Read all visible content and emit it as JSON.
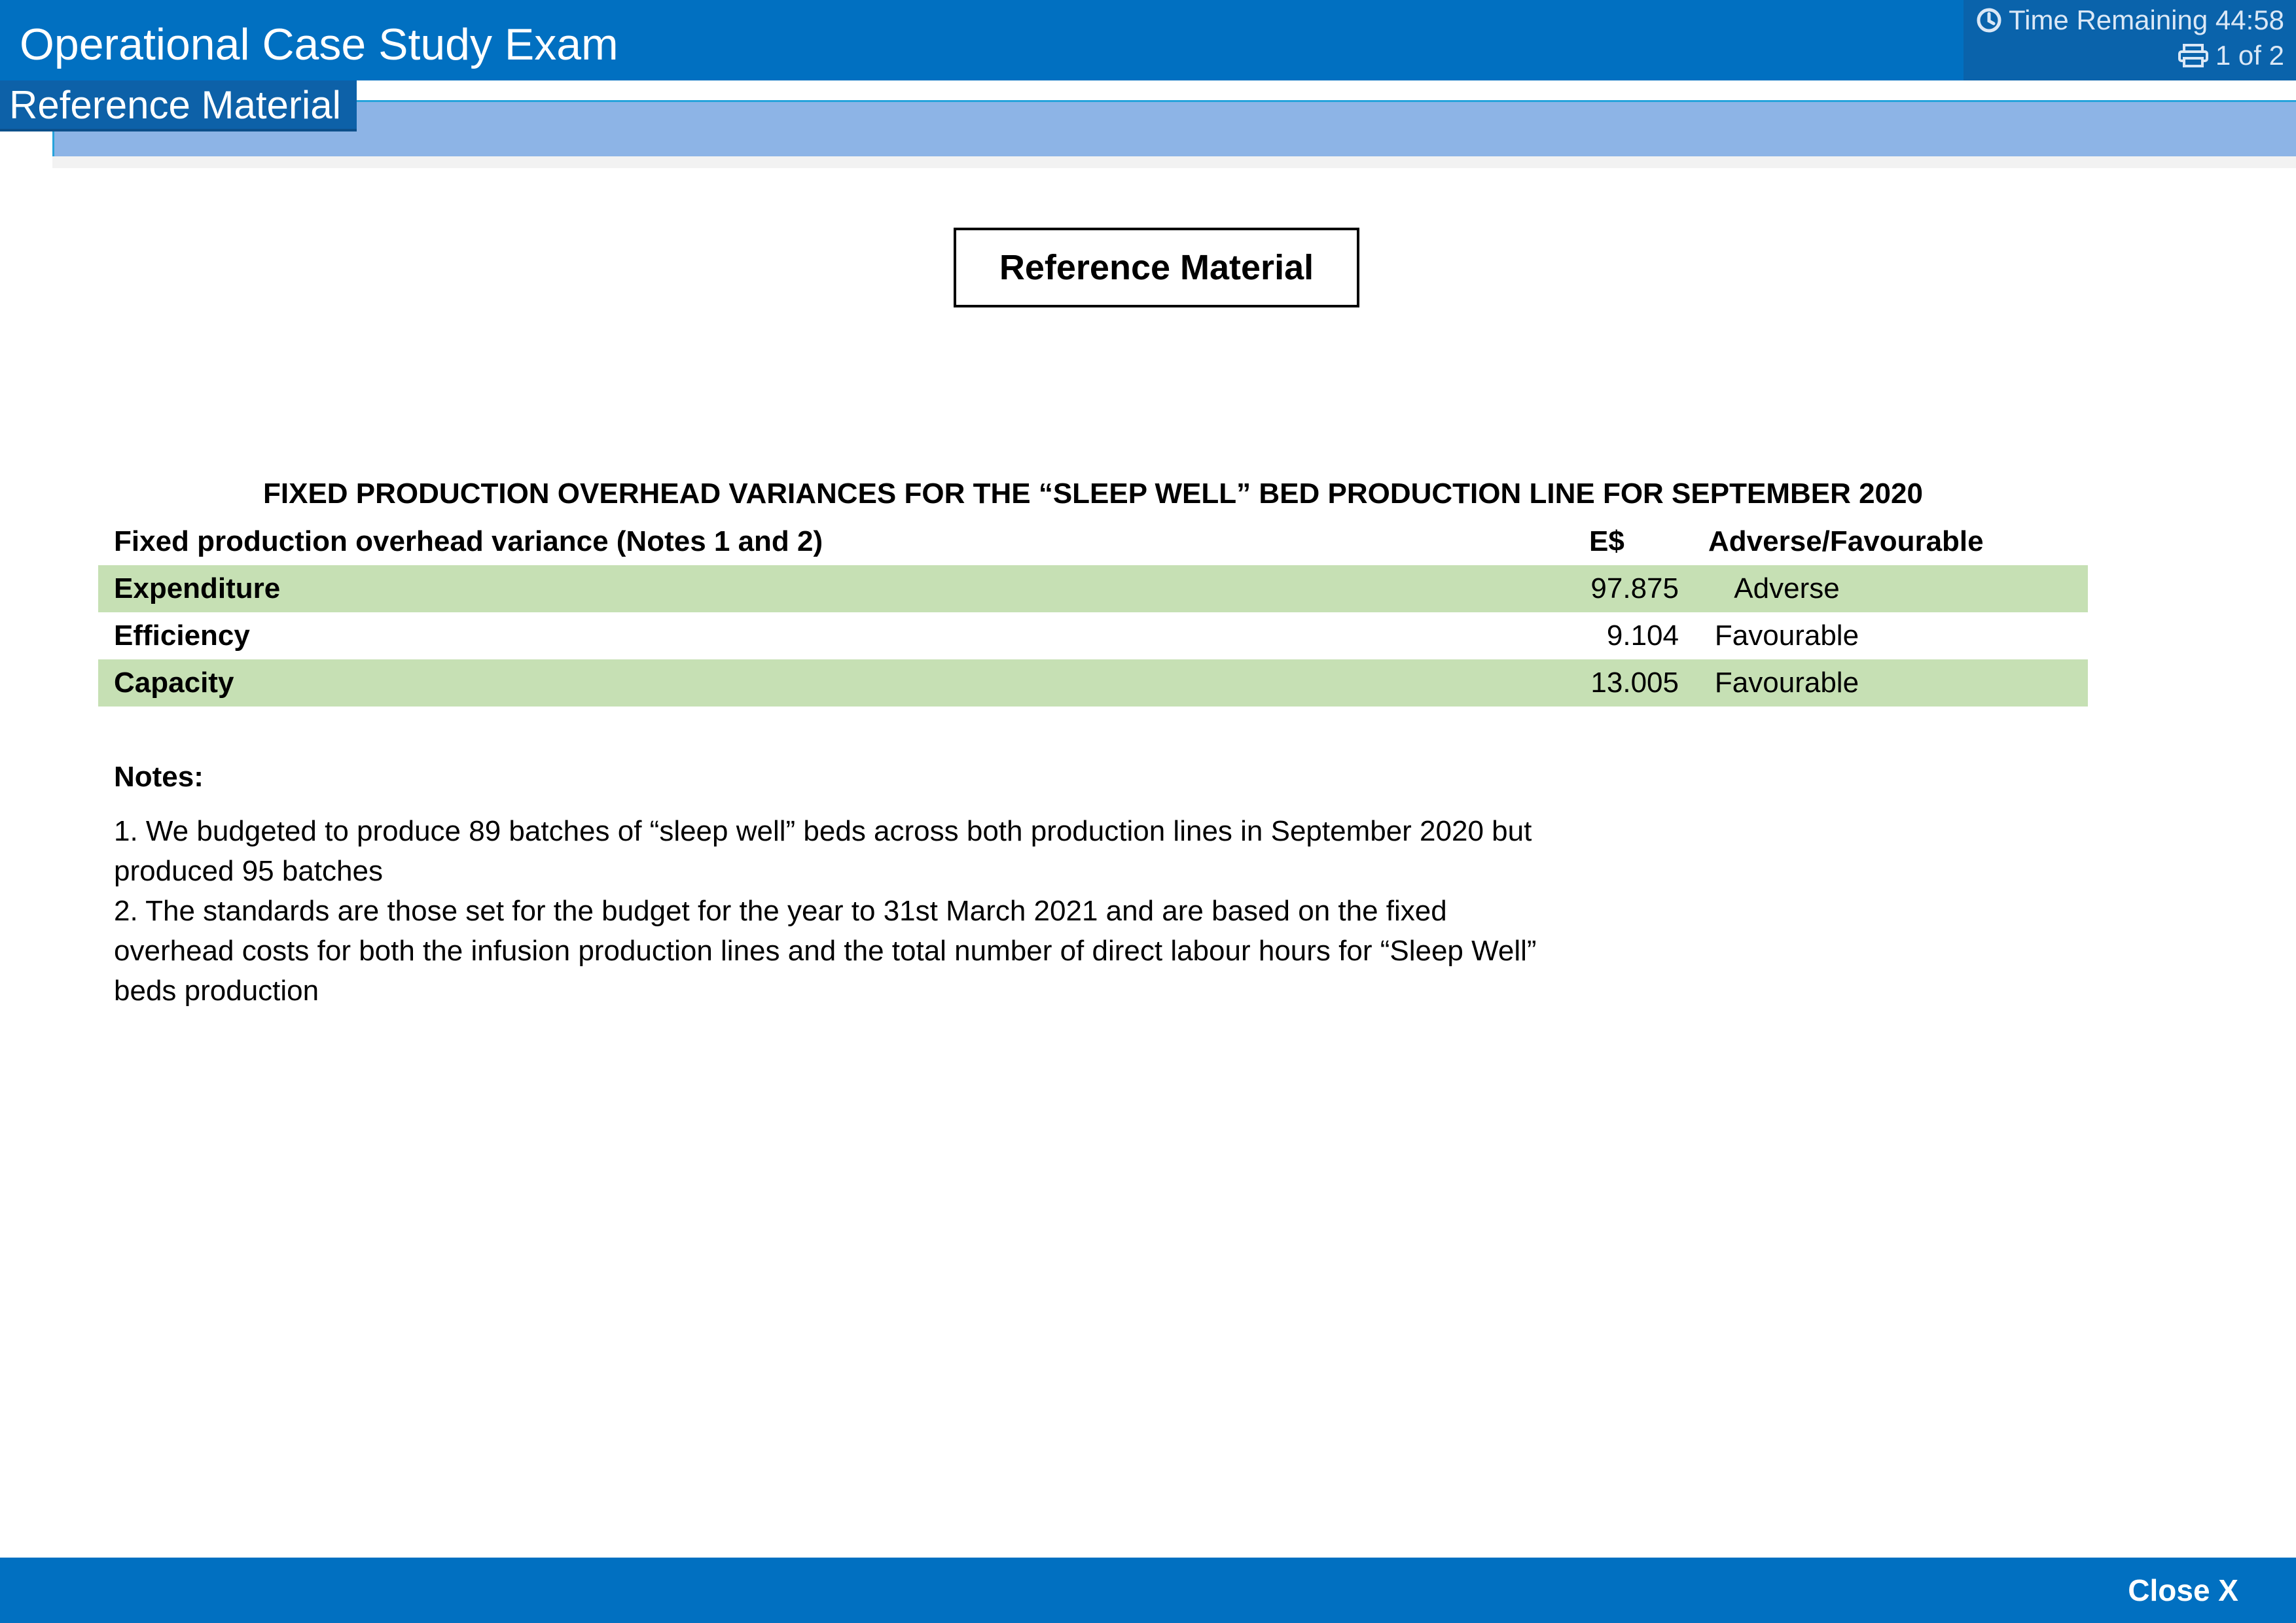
{
  "header": {
    "app_title": "Operational Case Study Exam",
    "timer_label": "Time Remaining 44:58",
    "page_indicator": "1 of 2"
  },
  "section_tab": {
    "label": "Reference Material"
  },
  "content": {
    "reference_heading": "Reference Material",
    "table_title": "FIXED PRODUCTION OVERHEAD VARIANCES FOR THE “SLEEP WELL” BED PRODUCTION LINE FOR SEPTEMBER 2020",
    "table": {
      "headers": {
        "name": "Fixed production overhead variance (Notes 1 and 2)",
        "value": "E$",
        "status": "Adverse/Favourable"
      },
      "rows": [
        {
          "name": "Expenditure",
          "value": "97.875",
          "status": "Adverse"
        },
        {
          "name": "Efficiency",
          "value": "9.104",
          "status": "Favourable"
        },
        {
          "name": "Capacity",
          "value": "13.005",
          "status": "Favourable"
        }
      ]
    },
    "notes_title": "Notes:",
    "notes": [
      "1. We budgeted to produce 89 batches of “sleep well” beds across both production lines in September 2020 but produced 95 batches",
      "2. The standards are those set for the budget for the year to 31st March 2021 and are based on the fixed overhead costs for both the infusion production lines and the total number of direct labour hours for “Sleep Well” beds production"
    ]
  },
  "footer": {
    "close_label": "Close X"
  },
  "icons": {
    "timer": "clock-icon",
    "pager": "printer-icon"
  },
  "colors": {
    "header_blue": "#0170c1",
    "band_blue": "#8db4e6",
    "row_shade": "#c6e0b4"
  }
}
